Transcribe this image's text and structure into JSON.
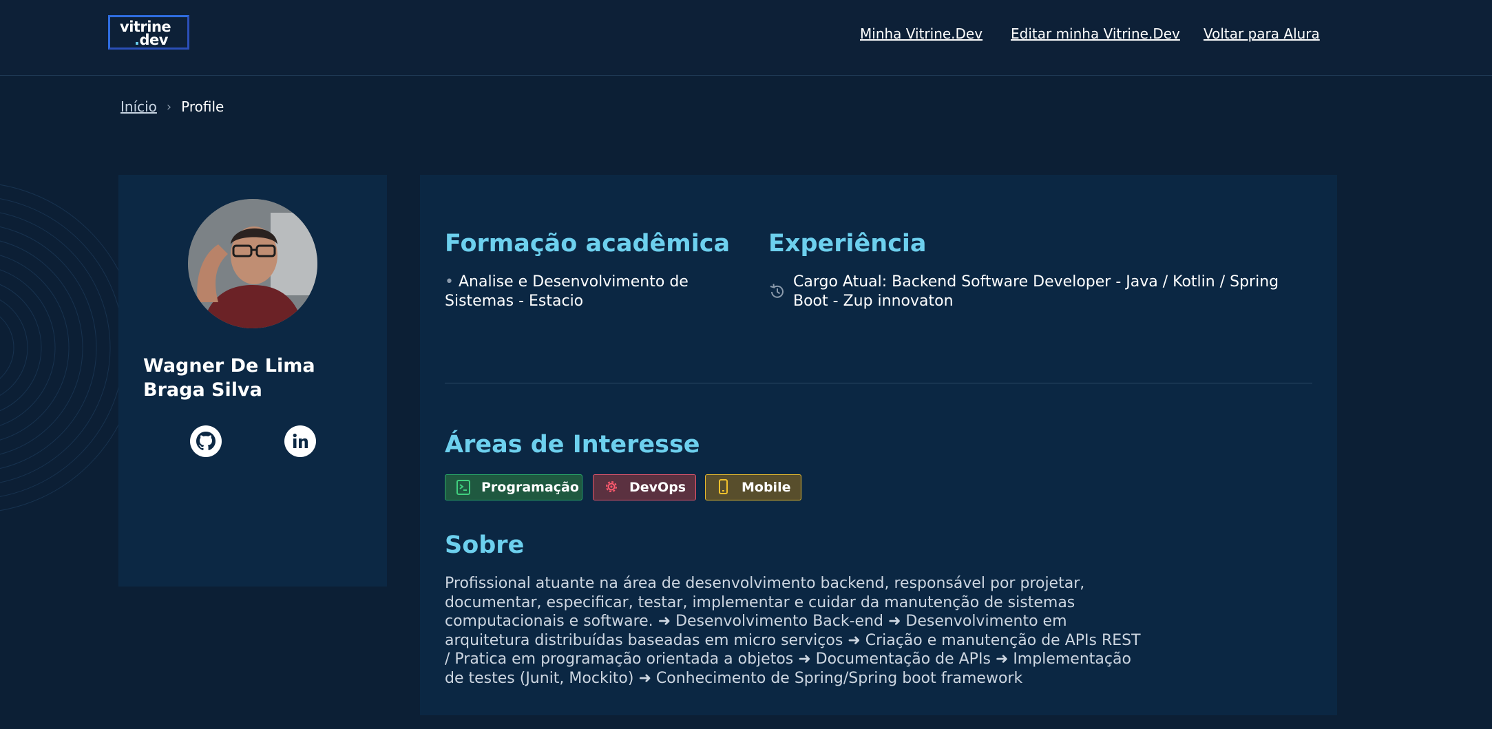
{
  "header": {
    "logo": {
      "line1": "vitrine",
      "line2_dot": ".",
      "line2": "dev"
    },
    "nav": [
      {
        "label": "Minha Vitrine.Dev"
      },
      {
        "label": "Editar minha Vitrine.Dev"
      },
      {
        "label": "Voltar para Alura"
      }
    ]
  },
  "breadcrumb": {
    "home": "Início",
    "separator": "›",
    "current": "Profile"
  },
  "profile": {
    "name": "Wagner De Lima Braga Silva",
    "avatar_icon": "profile-photo",
    "social": [
      {
        "icon": "github-icon"
      },
      {
        "icon": "linkedin-icon"
      }
    ]
  },
  "education": {
    "title": "Formação acadêmica",
    "bullet": "•",
    "item": "Analise e Desenvolvimento de Sistemas - Estacio"
  },
  "experience": {
    "title": "Experiência",
    "icon": "history-icon",
    "item": "Cargo Atual: Backend Software Developer - Java / Kotlin / Spring Boot - Zup innovaton"
  },
  "interests": {
    "title": "Áreas de Interesse",
    "tags": [
      {
        "label": "Programação",
        "icon": "terminal-icon",
        "color": "#2aa866"
      },
      {
        "label": "DevOps",
        "icon": "gear-icon",
        "color": "#e0556a"
      },
      {
        "label": "Mobile",
        "icon": "smartphone-icon",
        "color": "#e9bb2c"
      }
    ]
  },
  "about": {
    "title": "Sobre",
    "text": "Profissional atuante na área de desenvolvimento backend, responsável por projetar, documentar, especificar, testar, implementar e cuidar da manutenção de sistemas computacionais e software. ➜ Desenvolvimento Back-end ➜ Desenvolvimento em arquitetura distribuídas baseadas em micro serviços ➜ Criação e manutenção de APIs REST / Pratica em programação orientada a objetos ➜ Documentação de APIs ➜ Implementação de testes (Junit, Mockito) ➜ Conhecimento de Spring/Spring boot framework"
  },
  "colors": {
    "background": "#0c1f35",
    "accent": "#6dd0ee",
    "card": "#0b2743"
  }
}
